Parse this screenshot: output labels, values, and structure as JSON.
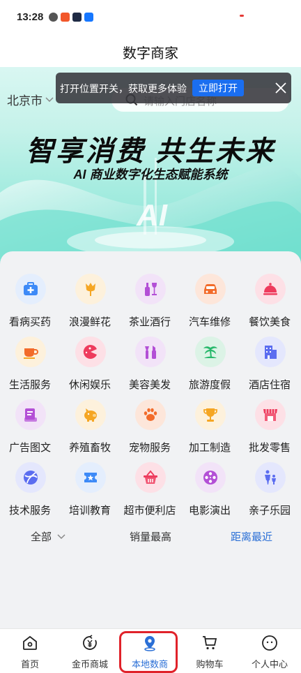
{
  "status_bar": {
    "time": "13:28"
  },
  "header": {
    "title": "数字商家"
  },
  "banner": {
    "city": "北京市",
    "search_placeholder": "请输入门店名称",
    "toast_text": "打开位置开关，获取更多体验",
    "toast_button": "立即打开",
    "slogan_main": "智享消费 共生未来",
    "slogan_sub": "AI 商业数字化生态赋能系统",
    "ai_mark": "AI"
  },
  "categories": [
    {
      "label": "看病买药",
      "icon": "medical-kit-icon",
      "color": "#3d8af7"
    },
    {
      "label": "浪漫鲜花",
      "icon": "tulip-icon",
      "color": "#f5a623"
    },
    {
      "label": "茶业酒行",
      "icon": "wine-bottle-icon",
      "color": "#b34fd6"
    },
    {
      "label": "汽车维修",
      "icon": "car-icon",
      "color": "#f26b2a"
    },
    {
      "label": "餐饮美食",
      "icon": "food-cloche-icon",
      "color": "#ee3b5d"
    },
    {
      "label": "生活服务",
      "icon": "coffee-cup-icon",
      "color": "#f5a623"
    },
    {
      "label": "休闲娱乐",
      "icon": "pacman-icon",
      "color": "#ee3b5d"
    },
    {
      "label": "美容美发",
      "icon": "cosmetics-icon",
      "color": "#b34fd6"
    },
    {
      "label": "旅游度假",
      "icon": "palm-tree-icon",
      "color": "#26b86a"
    },
    {
      "label": "酒店住宿",
      "icon": "building-icon",
      "color": "#5b6df0"
    },
    {
      "label": "广告图文",
      "icon": "document-icon",
      "color": "#b34fd6"
    },
    {
      "label": "养殖畜牧",
      "icon": "pig-icon",
      "color": "#f5a623"
    },
    {
      "label": "宠物服务",
      "icon": "paw-icon",
      "color": "#f26b2a"
    },
    {
      "label": "加工制造",
      "icon": "trophy-icon",
      "color": "#f5a623"
    },
    {
      "label": "批发零售",
      "icon": "shop-icon",
      "color": "#ee3b5d"
    },
    {
      "label": "技术服务",
      "icon": "globe-icon",
      "color": "#5b6df0"
    },
    {
      "label": "培训教育",
      "icon": "ticket-star-icon",
      "color": "#3d8af7"
    },
    {
      "label": "超市便利店",
      "icon": "basket-icon",
      "color": "#ee3b5d"
    },
    {
      "label": "电影演出",
      "icon": "film-reel-icon",
      "color": "#b34fd6"
    },
    {
      "label": "亲子乐园",
      "icon": "parent-child-icon",
      "color": "#5b6df0"
    }
  ],
  "sort": {
    "all": "全部",
    "sales": "销量最高",
    "distance": "距离最近"
  },
  "nav": [
    {
      "label": "首页",
      "icon": "home-icon"
    },
    {
      "label": "金币商城",
      "icon": "coin-mall-icon"
    },
    {
      "label": "本地数商",
      "icon": "location-pin-icon"
    },
    {
      "label": "购物车",
      "icon": "cart-icon"
    },
    {
      "label": "个人中心",
      "icon": "profile-icon"
    }
  ],
  "colors": {
    "accent": "#2a6fd6",
    "highlight_border": "#e0222a",
    "toast_button": "#1a6ef0"
  }
}
